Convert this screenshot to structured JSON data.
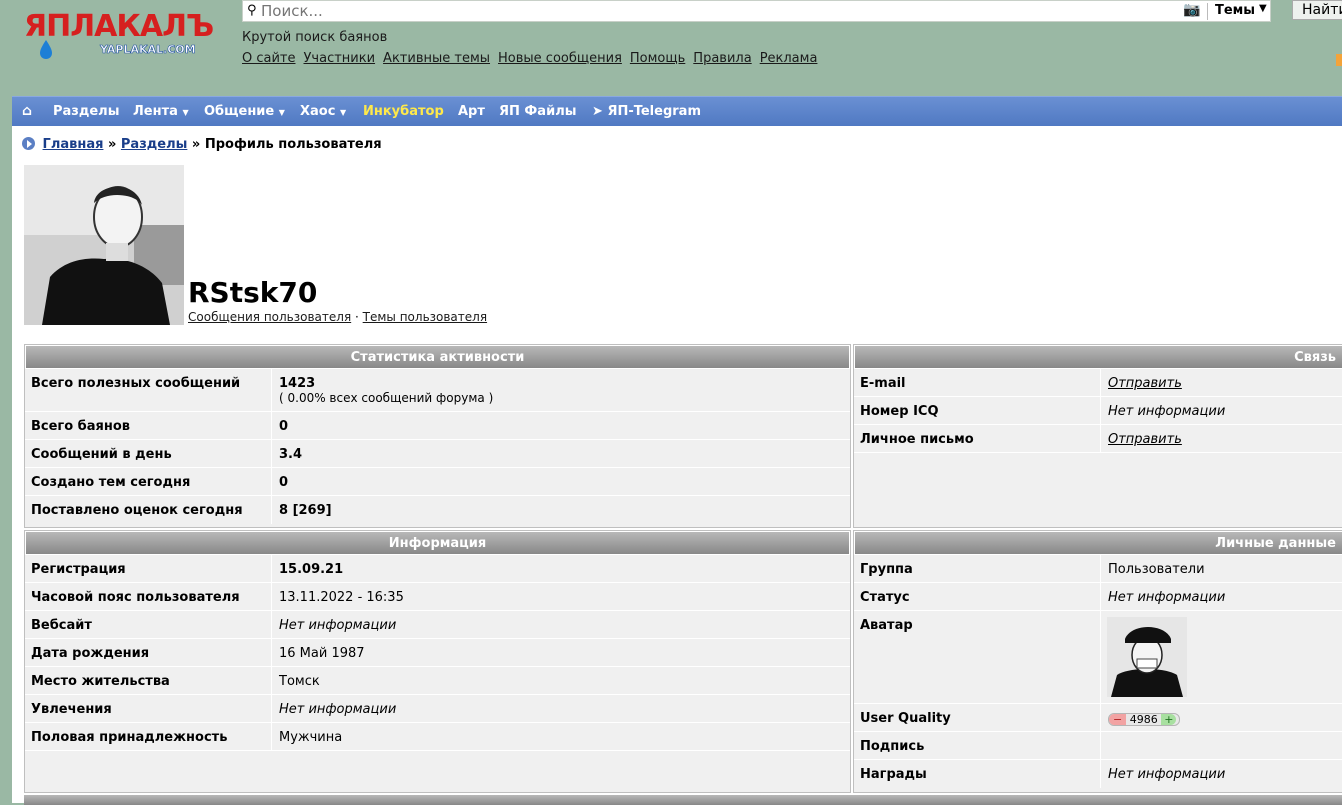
{
  "header": {
    "logo_text": "ЯПЛАКАЛЪ",
    "logo_sub": "YAPLAKAL.COM",
    "search_placeholder": "Поиск...",
    "search_scope": "Темы",
    "find_button": "Найти",
    "tagline": "Крутой поиск баянов",
    "links": [
      "О сайте",
      "Участники",
      "Активные темы",
      "Новые сообщения",
      "Помощь",
      "Правила",
      "Реклама"
    ]
  },
  "nav": {
    "home_icon": "home-icon",
    "items": [
      "Разделы",
      "Лента",
      "Общение",
      "Хаос",
      "Инкубатор",
      "Арт",
      "ЯП Файлы",
      "ЯП-Telegram"
    ],
    "highlight_color": "#ffe94a"
  },
  "breadcrumb": {
    "home": "Главная",
    "sep": "»",
    "sections": "Разделы",
    "current": "Профиль пользователя"
  },
  "profile": {
    "username": "RStsk70",
    "posts_link": "Сообщения пользователя",
    "link_sep": "·",
    "topics_link": "Темы пользователя"
  },
  "stats": {
    "title": "Статистика активности",
    "rows": [
      {
        "label": "Всего полезных сообщений",
        "value": "1423",
        "sub": "( 0.00% всех сообщений форума )"
      },
      {
        "label": "Всего баянов",
        "value": "0"
      },
      {
        "label": "Сообщений в день",
        "value": "3.4"
      },
      {
        "label": "Создано тем сегодня",
        "value": "0"
      },
      {
        "label": "Поставлено оценок сегодня",
        "value": "8 [269]"
      }
    ]
  },
  "contact": {
    "title": "Связь",
    "rows": [
      {
        "label": "E-mail",
        "value": "Отправить"
      },
      {
        "label": "Номер ICQ",
        "value": "Нет информации"
      },
      {
        "label": "Личное письмо",
        "value": "Отправить"
      }
    ]
  },
  "info": {
    "title": "Информация",
    "rows": [
      {
        "label": "Регистрация",
        "value": "15.09.21"
      },
      {
        "label": "Часовой пояс пользователя",
        "value": "13.11.2022 - 16:35"
      },
      {
        "label": "Вебсайт",
        "value": "Нет информации"
      },
      {
        "label": "Дата рождения",
        "value": "16 Май 1987"
      },
      {
        "label": "Место жительства",
        "value": "Томск"
      },
      {
        "label": "Увлечения",
        "value": "Нет информации"
      },
      {
        "label": "Половая принадлежность",
        "value": "Мужчина"
      }
    ]
  },
  "personal": {
    "title": "Личные данные",
    "rows": [
      {
        "label": "Группа",
        "value": "Пользователи"
      },
      {
        "label": "Статус",
        "value": "Нет информации"
      },
      {
        "label": "Аватар",
        "value": ""
      },
      {
        "label": "User Quality",
        "minus": "−",
        "value": "4986",
        "plus": "+"
      },
      {
        "label": "Подпись",
        "value": ""
      },
      {
        "label": "Награды",
        "value": "Нет информации"
      }
    ]
  }
}
